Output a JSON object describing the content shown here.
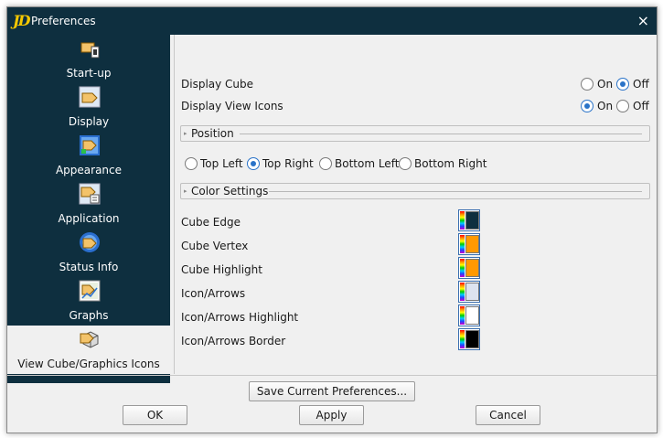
{
  "window": {
    "title": "Preferences",
    "close_glyph": "×",
    "app_icon_text": "JD",
    "app_icon": "jd-app-icon"
  },
  "sidebar": {
    "items": [
      {
        "label": "Start-up",
        "icon": "startup-icon"
      },
      {
        "label": "Display",
        "icon": "display-icon"
      },
      {
        "label": "Appearance",
        "icon": "appearance-icon"
      },
      {
        "label": "Application",
        "icon": "application-icon"
      },
      {
        "label": "Status Info",
        "icon": "status-info-icon"
      },
      {
        "label": "Graphs",
        "icon": "graphs-icon"
      },
      {
        "label": "View Cube/Graphics Icons",
        "icon": "view-cube-icon",
        "selected": true
      }
    ]
  },
  "settings": {
    "display_cube": {
      "label": "Display Cube",
      "on_label": "On",
      "off_label": "Off",
      "value": "Off"
    },
    "display_view_icons": {
      "label": "Display View Icons",
      "on_label": "On",
      "off_label": "Off",
      "value": "On"
    }
  },
  "position_section": {
    "title": "Position",
    "options": [
      "Top Left",
      "Top Right",
      "Bottom Left",
      "Bottom Right"
    ],
    "selected": "Top Right"
  },
  "color_section": {
    "title": "Color Settings",
    "rows": [
      {
        "label": "Cube Edge",
        "color": "#0e2f3f"
      },
      {
        "label": "Cube Vertex",
        "color": "#ff9900"
      },
      {
        "label": "Cube Highlight",
        "color": "#ff9900"
      },
      {
        "label": "Icon/Arrows",
        "color": "#dde3ef"
      },
      {
        "label": "Icon/Arrows Highlight",
        "color": "#ffffff"
      },
      {
        "label": "Icon/Arrows Border",
        "color": "#000000"
      }
    ]
  },
  "buttons": {
    "save": "Save Current Preferences...",
    "ok": "OK",
    "apply": "Apply",
    "cancel": "Cancel"
  },
  "colors": {
    "sidebar_bg": "#0e2f3f",
    "radio_accent": "#2a73c8",
    "panel_bg": "#f0f0f0"
  }
}
